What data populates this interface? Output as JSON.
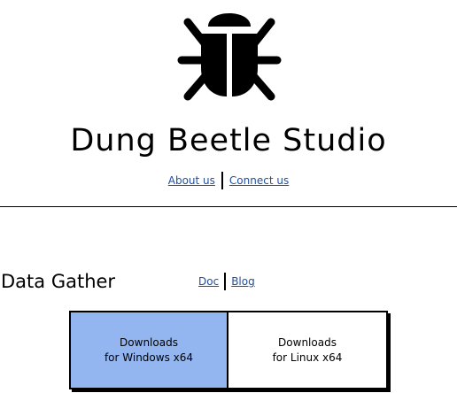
{
  "header": {
    "logo_icon": "bug-icon",
    "title": "Dung Beetle Studio",
    "links": [
      {
        "label": "About us"
      },
      {
        "label": "Connect us"
      }
    ]
  },
  "section": {
    "title": "Data Gather",
    "links": [
      {
        "label": "Doc"
      },
      {
        "label": "Blog"
      }
    ],
    "downloads": [
      {
        "line1": "Downloads",
        "line2": "for Windows x64",
        "color": "#93b6f0"
      },
      {
        "line1": "Downloads",
        "line2": "for Linux x64",
        "color": "#ffffff"
      }
    ]
  },
  "colors": {
    "link": "#1f4fa0",
    "highlight": "#93b6f0"
  }
}
